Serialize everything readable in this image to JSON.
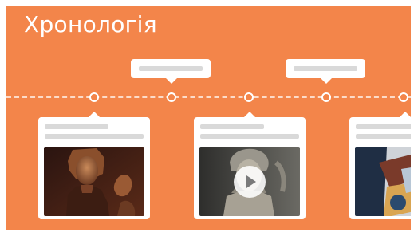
{
  "header": {
    "title": "Хронологія"
  },
  "timeline": {
    "callout_count": 2,
    "card_count": 3
  },
  "cards": [
    {
      "media": "image",
      "icon": "egyptian-bust-image"
    },
    {
      "media": "video",
      "icon": "play-icon"
    },
    {
      "media": "image",
      "icon": "abstract-sculpture-image"
    }
  ],
  "colors": {
    "background": "#f3854a",
    "card": "#ffffff",
    "placeholder": "#d9d9d9"
  }
}
